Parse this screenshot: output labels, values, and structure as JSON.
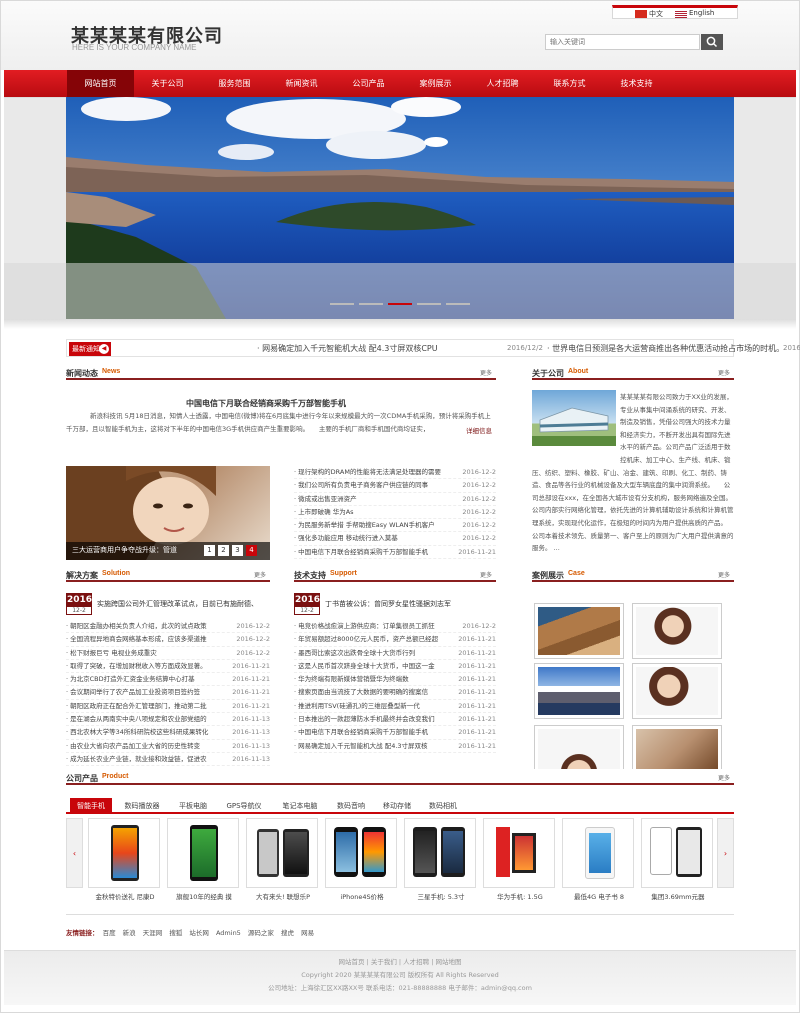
{
  "lang": {
    "cn": "中文",
    "en": "English"
  },
  "logo": {
    "cn": "某某某某有限公司",
    "en": "HERE IS YOUR COMPANY NAME"
  },
  "search": {
    "placeholder": "输入关键词"
  },
  "nav": [
    "网站首页",
    "关于公司",
    "服务范围",
    "新闻资讯",
    "公司产品",
    "案例展示",
    "人才招聘",
    "联系方式",
    "技术支持"
  ],
  "notice": {
    "tag": "最新通知",
    "items": [
      {
        "text": "· 网易确定加入千元智能机大战 配4.3寸屏双核CPU",
        "date": "2016/12/2"
      },
      {
        "text": "· 世界电信日预测是各大运营商推出各种优惠活动抢占市场的时机。",
        "date": "2016/12/2"
      }
    ]
  },
  "news": {
    "title": "新闻动态",
    "en": "News",
    "more": "更多",
    "headline": "中国电信下月联合经销商采购千万部智能手机",
    "summary": "新浪科技讯 5月18日消息，知情人士透露，中国电信(微博)将在6月底集中进行今年以来规模最大的一次CDMA手机采购，预计将采购手机上千万部，且以智能手机为主，这将对下半年的中国电信3G手机供应商产生重要影响。　　主要的手机厂商和手机国代商均证实，",
    "detail": "详细信息",
    "caption": "三大运营商用户争夺战升级：管道",
    "pages": [
      "1",
      "2",
      "3",
      "4"
    ],
    "list": [
      {
        "t": "· 现行架构的DRAM的性能将无法满足处理器的需要",
        "d": "2016-12-2"
      },
      {
        "t": "· 我们公司所有负责电子商务客户供应链的同事",
        "d": "2016-12-2"
      },
      {
        "t": "· 微成或出售亚洲资产",
        "d": "2016-12-2"
      },
      {
        "t": "· 上市即破确 华为As",
        "d": "2016-12-2"
      },
      {
        "t": "· 为民服务新举措 手帮助搜Easy WLAN手机客户",
        "d": "2016-12-2"
      },
      {
        "t": "· 强化多功能应用 移动统行进入莫基",
        "d": "2016-12-2"
      },
      {
        "t": "· 中国电信下月联合经销商采购千万部智能手机",
        "d": "2016-11-21"
      }
    ]
  },
  "about": {
    "title": "关于公司",
    "en": "About",
    "more": "更多",
    "text": "某某某某有限公司致力于XX业的发展，专业从事集中间涌系统的研究、开发、制造及销售，凭借公司强大的技术力量和经济实力，不断开发出具有国际先进水平的新产品。公司产品广泛适用于数控机床、加工中心、生产线、机床、锻压、纺织、塑料、橡胶、矿山、冶金、建筑、印刷、化工、制药、铸造、食品等各行业的机械设备及大型车辆底盘的集中润滑系统。　　公司总部设在xxx，在全国各大城市设有分支机构，服务网络遍及全国。公司内部实行网络化管理，依托先进的计算机辅助设计系统和计算机管理系统，实现现代化运作，在极短的时间内为用户提供高质的产品。　公司本着技术领先、质量第一、客户至上的原则为广大用户提供满意的服务。 ..."
  },
  "solution": {
    "title": "解决方案",
    "en": "Solution",
    "more": "更多",
    "year": "2016",
    "md": "12-2",
    "top": "实施跨国公司外汇管理改革试点，目前已有施耐德、",
    "list": [
      {
        "t": "· 朝阳区金融办相关负责人介绍，此次的试点政策",
        "d": "2016-12-2"
      },
      {
        "t": "· 全国流程异地商会网络基本形成，应该多渠道推",
        "d": "2016-12-2"
      },
      {
        "t": "· 松下财报巨亏 电视业务成重灾",
        "d": "2016-12-2"
      },
      {
        "t": "· 取得了突破，在增加财税收入等方面成效显著。",
        "d": "2016-11-21"
      },
      {
        "t": "· 为北京CBD打造外汇资金业务结算中心打基",
        "d": "2016-11-21"
      },
      {
        "t": "· 会议期间举行了农产品加工业投资项目签约签",
        "d": "2016-11-21"
      },
      {
        "t": "· 朝阳区政府正在配合外汇管理部门，推动第二批",
        "d": "2016-11-21"
      },
      {
        "t": "· 是在湖会从两南实中央八项规定和农业部党组的",
        "d": "2016-11-13"
      },
      {
        "t": "· 西北农林大学等34所科研院校这些科研成果转化",
        "d": "2016-11-13"
      },
      {
        "t": "· 由农业大省向农产品加工业大省的历史性转变",
        "d": "2016-11-13"
      },
      {
        "t": "· 成为延长农业产业链，就业接和效益链，促进农",
        "d": "2016-11-13"
      }
    ]
  },
  "support": {
    "title": "技术支持",
    "en": "Support",
    "more": "更多",
    "year": "2016",
    "md": "12-2",
    "top": "丁书苗被公诉：曾同罗女星性骚据刘志军",
    "list": [
      {
        "t": "· 电竞价格战愈演上游供应商：订单集很员工抓狂",
        "d": "2016-12-2"
      },
      {
        "t": "· 年贸易额超过8000亿元人民币，资产总额已经超",
        "d": "2016-11-21"
      },
      {
        "t": "· 墨西哥比索这次出跌骨全球十大货币行列",
        "d": "2016-11-21"
      },
      {
        "t": "· 这是人民币首次跻身全球十大货币，中国这一金",
        "d": "2016-11-21"
      },
      {
        "t": "· 华为终端有限新媒体营销暨华为终端数",
        "d": "2016-11-21"
      },
      {
        "t": "· 搜索页面由当流技了大数据的要明确的搜案信",
        "d": "2016-11-21"
      },
      {
        "t": "· 推进利用TSV(硅通孔)的三维层叠型新一代",
        "d": "2016-11-21"
      },
      {
        "t": "· 日本推出的一款超薄防水手机最终并会改变我们",
        "d": "2016-11-21"
      },
      {
        "t": "· 中国电信下月联合经销商采购千万部智能手机",
        "d": "2016-11-21"
      },
      {
        "t": "· 网易确定加入千元智能机大战 配4.3寸屏双核",
        "d": "2016-11-21"
      }
    ]
  },
  "cases": {
    "title": "案例展示",
    "en": "Case",
    "more": "更多"
  },
  "products": {
    "title": "公司产品",
    "en": "Product",
    "more": "更多",
    "tabs": [
      "智能手机",
      "数码播放器",
      "平板电脑",
      "GPS导航仪",
      "笔记本电脑",
      "数码音响",
      "移动存储",
      "数码相机"
    ],
    "prev": "‹",
    "next": "›",
    "items": [
      "金秋特价送礼 尼康D",
      "旗舰10年的经典 摸",
      "大有来头! 联想乐P",
      "iPhone4S价格",
      "三星手机: 5.3寸",
      "华为手机: 1.5G",
      "最低4G 电子书 8",
      "集团3.69mm元器"
    ]
  },
  "links": {
    "label": "友情链接：",
    "items": [
      "百度",
      "新浪",
      "天涯网",
      "搜狐",
      "站长网",
      "Admin5",
      "源码之家",
      "搜虎",
      "网易"
    ]
  },
  "footer": {
    "nav": "网站首页 | 关于我们 | 人才招聘 | 网站地图",
    "copyright": "Copyright 2020 某某某某有限公司 版权所有 All Rights Reserved",
    "contact": "公司地址：上海徐汇区XX路XX号 联系电话：021-88888888 电子邮件：admin@qq.com"
  },
  "colors": {
    "accent": "#c8050a",
    "dark": "#8a1f1f",
    "date_box": "#7a1010"
  }
}
